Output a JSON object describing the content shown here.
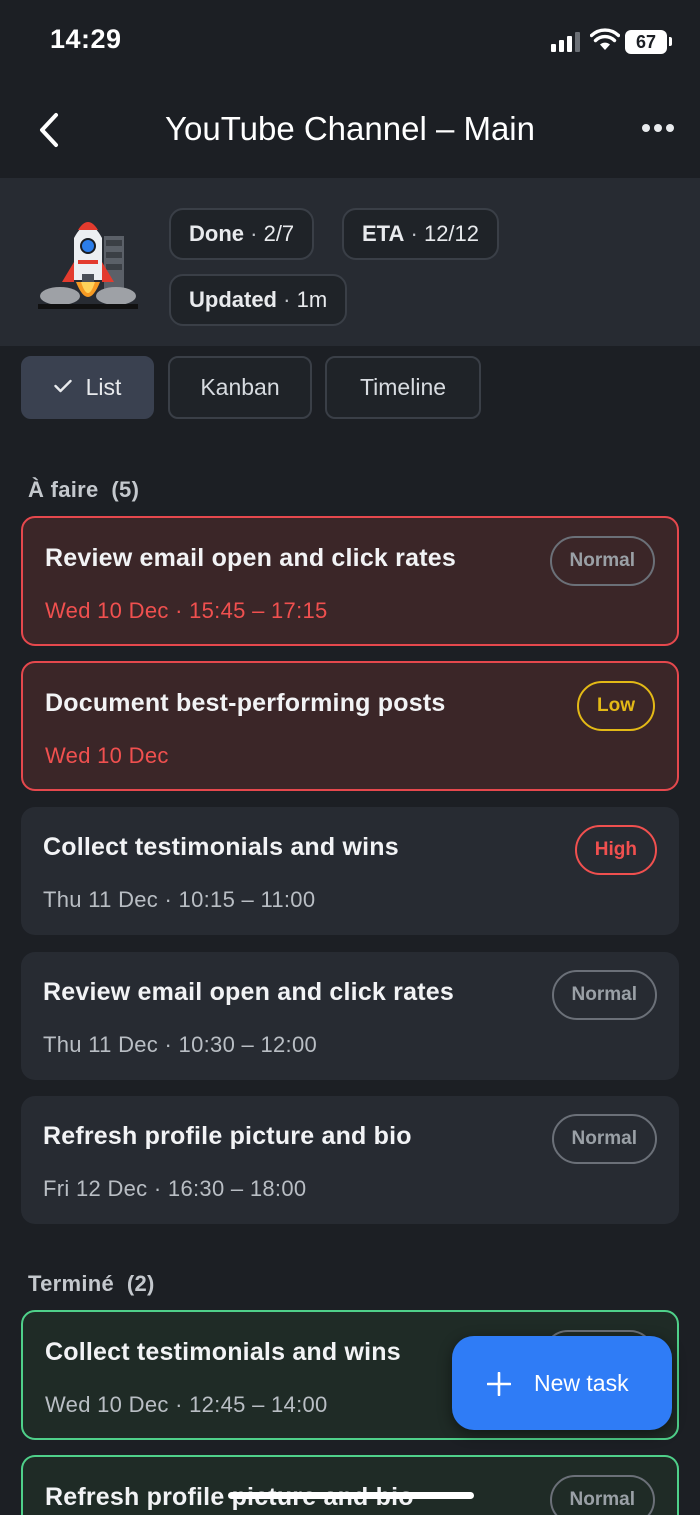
{
  "status": {
    "time": "14:29",
    "battery": "67"
  },
  "nav": {
    "title": "YouTube Channel – Main",
    "back_icon": "chevron-left-icon",
    "more_icon": "ellipsis-icon"
  },
  "summary": {
    "done_label": "Done",
    "done_value": "2/7",
    "eta_label": "ETA",
    "eta_value": "12/12",
    "updated_label": "Updated",
    "updated_value": "1m",
    "separator": "·"
  },
  "views": {
    "list": "List",
    "kanban": "Kanban",
    "timeline": "Timeline",
    "active": "list"
  },
  "sections": [
    {
      "title": "À faire",
      "count": "(5)",
      "tasks": [
        {
          "title": "Review email open and click rates",
          "when": "Wed 10 Dec · 15:45 – 17:15",
          "priority": "Normal",
          "state": "overdue"
        },
        {
          "title": "Document best-performing posts",
          "when": "Wed 10 Dec",
          "priority": "Low",
          "state": "overdue"
        },
        {
          "title": "Collect testimonials and wins",
          "when": "Thu 11 Dec · 10:15 – 11:00",
          "priority": "High",
          "state": "open"
        },
        {
          "title": "Review email open and click rates",
          "when": "Thu 11 Dec · 10:30 – 12:00",
          "priority": "Normal",
          "state": "open"
        },
        {
          "title": "Refresh profile picture and bio",
          "when": "Fri 12 Dec · 16:30 – 18:00",
          "priority": "Normal",
          "state": "open"
        }
      ]
    },
    {
      "title": "Terminé",
      "count": "(2)",
      "tasks": [
        {
          "title": "Collect testimonials and wins",
          "when": "Wed 10 Dec · 12:45 – 14:00",
          "priority": "",
          "state": "done"
        },
        {
          "title": "Refresh profile picture and bio",
          "when": "",
          "priority": "Normal",
          "state": "done"
        }
      ]
    }
  ],
  "fab": {
    "label": "New task",
    "icon": "plus-icon"
  },
  "colors": {
    "overdue": "#e5484d",
    "done": "#4fd08a",
    "accent": "#2f7cf6",
    "low": "#e3b916",
    "high": "#f0504f"
  }
}
